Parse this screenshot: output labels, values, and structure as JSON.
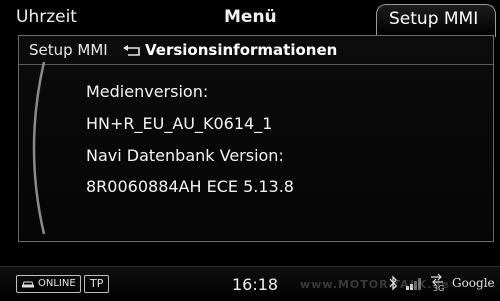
{
  "header": {
    "tab_left": "Uhrzeit",
    "tab_center": "Menü",
    "tab_active": "Setup MMI"
  },
  "breadcrumb": {
    "parent": "Setup MMI",
    "back_icon": "return-arrow-icon",
    "current": "Versionsinformationen"
  },
  "content": {
    "lines": [
      "Medienversion:",
      "HN+R_EU_AU_K0614_1",
      "Navi Datenbank Version:",
      "8R0060884AH ECE 5.13.8"
    ]
  },
  "statusbar": {
    "online_label": "ONLINE",
    "tp_label": "TP",
    "time": "16:18",
    "net_label": "3G",
    "google_label": "Google",
    "icons": [
      "car-icon",
      "bluetooth-icon",
      "signal-icon",
      "network-transfer-icon"
    ]
  },
  "watermark": "www.MOTOR-TALK.de",
  "colors": {
    "background": "#000000",
    "frame": "#6a6a6a",
    "text": "#ffffff"
  }
}
